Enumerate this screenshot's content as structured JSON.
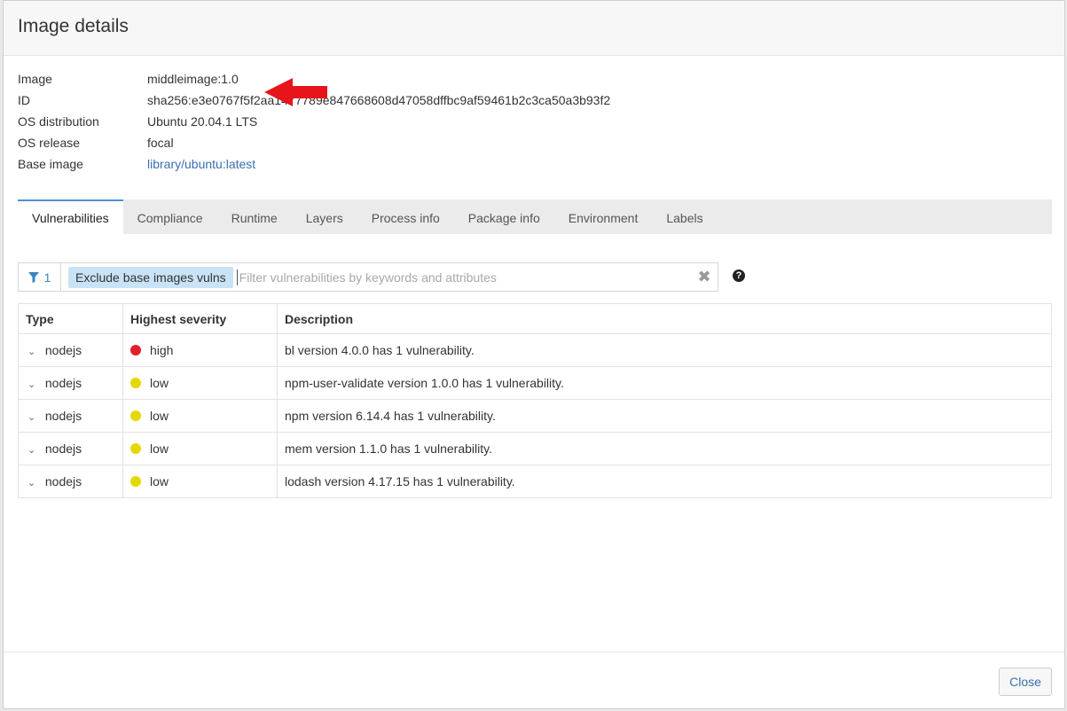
{
  "modal": {
    "title": "Image details"
  },
  "details": [
    {
      "label": "Image",
      "value": "middleimage:1.0"
    },
    {
      "label": "ID",
      "value": "sha256:e3e0767f5f2aa1477789e847668608d47058dffbc9af59461b2c3ca50a3b93f2"
    },
    {
      "label": "OS distribution",
      "value": "Ubuntu 20.04.1 LTS"
    },
    {
      "label": "OS release",
      "value": "focal"
    },
    {
      "label": "Base image",
      "value": "library/ubuntu:latest"
    }
  ],
  "tabs": [
    "Vulnerabilities",
    "Compliance",
    "Runtime",
    "Layers",
    "Process info",
    "Package info",
    "Environment",
    "Labels"
  ],
  "active_tab": "Vulnerabilities",
  "filter": {
    "count": "1",
    "chip": "Exclude base images vulns",
    "placeholder": "Filter vulnerabilities by keywords and attributes",
    "clear_icon": "close-icon",
    "help_icon": "question-circle-icon"
  },
  "table": {
    "headers": [
      "Type",
      "Highest severity",
      "Description"
    ],
    "rows": [
      {
        "type": "nodejs",
        "severity": "high",
        "severity_color": "#e0202a",
        "description": "bl version 4.0.0 has 1 vulnerability."
      },
      {
        "type": "nodejs",
        "severity": "low",
        "severity_color": "#e5d800",
        "description": "npm-user-validate version 1.0.0 has 1 vulnerability."
      },
      {
        "type": "nodejs",
        "severity": "low",
        "severity_color": "#e5d800",
        "description": "npm version 6.14.4 has 1 vulnerability."
      },
      {
        "type": "nodejs",
        "severity": "low",
        "severity_color": "#e5d800",
        "description": "mem version 1.1.0 has 1 vulnerability."
      },
      {
        "type": "nodejs",
        "severity": "low",
        "severity_color": "#e5d800",
        "description": "lodash version 4.17.15 has 1 vulnerability."
      }
    ]
  },
  "footer": {
    "close_label": "Close"
  },
  "colors": {
    "accent": "#4a90d9",
    "link": "#3a6fb0",
    "annotation_arrow": "#e8141c"
  }
}
